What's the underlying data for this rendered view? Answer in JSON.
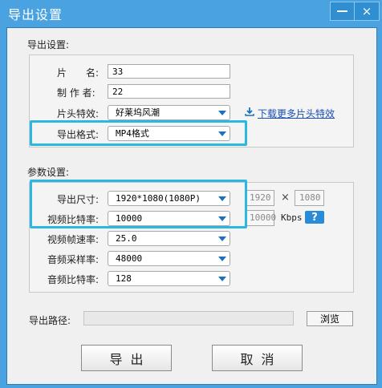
{
  "window": {
    "title": "导出设置",
    "close_icon": "×"
  },
  "export_settings": {
    "section_title": "导出设置:",
    "piece_name_label": "片　　名:",
    "piece_name_value": "33",
    "author_label": "制 作 者:",
    "author_value": "22",
    "intro_effect_label": "片头特效:",
    "intro_effect_value": "好莱坞风潮",
    "download_link": "下载更多片头特效",
    "format_label": "导出格式:",
    "format_value": "MP4格式"
  },
  "params": {
    "section_title": "参数设置:",
    "size_label": "导出尺寸:",
    "size_value": "1920*1080(1080P)",
    "width_value": "1920",
    "times_symbol": "×",
    "height_value": "1080",
    "vbitrate_label": "视频比特率:",
    "vbitrate_value": "10000",
    "vbitrate_custom": "10000",
    "kbps": "Kbps",
    "help": "?",
    "framerate_label": "视频帧速率:",
    "framerate_value": "25.0",
    "samplerate_label": "音频采样率:",
    "samplerate_value": "48000",
    "abitrate_label": "音频比特率:",
    "abitrate_value": "128"
  },
  "output": {
    "path_label": "导出路径:",
    "browse_label": "浏览"
  },
  "buttons": {
    "export_label": "导出",
    "cancel_label": "取消"
  },
  "colors": {
    "title_bar": "#4aa3e0",
    "highlight": "#2bb7e0",
    "link": "#1a4fb0"
  }
}
